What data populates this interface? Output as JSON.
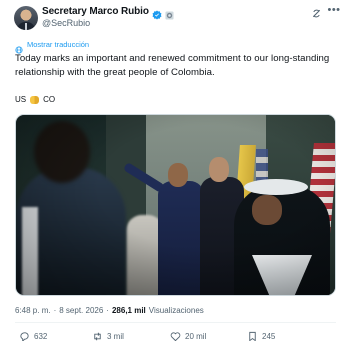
{
  "author": {
    "display_name": "Secretary Marco Rubio",
    "handle": "@SecRubio"
  },
  "translate_label": "Mostrar traducción",
  "tweet_text": "Today marks an important and renewed commitment to our long-standing relationship with the great people of Colombia.",
  "flags_left": "US",
  "flags_right": "CO",
  "meta": {
    "time": "6:48 p. m.",
    "separator1": "·",
    "date": "8 sept. 2026",
    "separator2": "·",
    "views_count": "286,1 mil",
    "views_label": "Visualizaciones"
  },
  "actions": {
    "replies": "632",
    "reposts": "3 mil",
    "likes": "20 mil",
    "bookmarks": "245"
  },
  "colors": {
    "accent": "#1d9bf0",
    "secondary_text": "#536471",
    "verified_badge": "#1d9bf0"
  },
  "icons": [
    "verified-badge-icon",
    "government-seal-icon",
    "grok-icon",
    "more-icon",
    "globe-icon",
    "handshake-icon",
    "reply-icon",
    "repost-icon",
    "like-icon",
    "bookmark-icon"
  ]
}
